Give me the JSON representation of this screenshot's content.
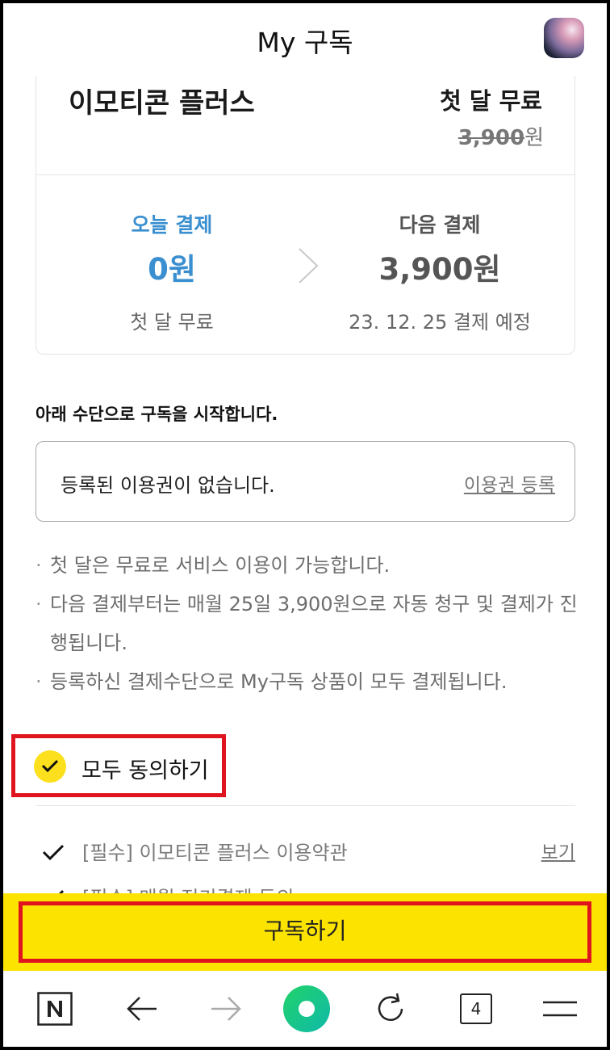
{
  "header": {
    "title": "My 구독"
  },
  "product": {
    "name": "이모티콘 플러스",
    "promo": "첫 달 무료",
    "original_price": "3,900",
    "currency": "원"
  },
  "payment": {
    "today": {
      "label": "오늘 결제",
      "amount": "0원",
      "note": "첫 달 무료"
    },
    "next": {
      "label": "다음 결제",
      "amount": "3,900원",
      "note": "23. 12. 25 결제 예정"
    }
  },
  "method": {
    "title": "아래 수단으로 구독을 시작합니다.",
    "voucher_empty": "등록된 이용권이 없습니다.",
    "voucher_register": "이용권 등록"
  },
  "notes": [
    "첫 달은 무료로 서비스 이용이 가능합니다.",
    "다음 결제부터는 매월 25일 3,900원으로 자동 청구 및 결제가 진행됩니다.",
    "등록하신 결제수단으로 My구독 상품이 모두 결제됩니다."
  ],
  "agreement": {
    "all_label": "모두 동의하기",
    "terms": [
      {
        "label": "[필수] 이모티콘 플러스 이용약관",
        "view": "보기"
      },
      {
        "label": "[필수] 매월 정기결제 동의"
      }
    ]
  },
  "subscribe_button": "구독하기",
  "toolbar": {
    "tab_count": "4"
  },
  "colors": {
    "accent_yellow": "#fce300",
    "highlight_red": "#e0141e",
    "blue": "#3a8fd0",
    "brand_green": "#19ce60"
  }
}
